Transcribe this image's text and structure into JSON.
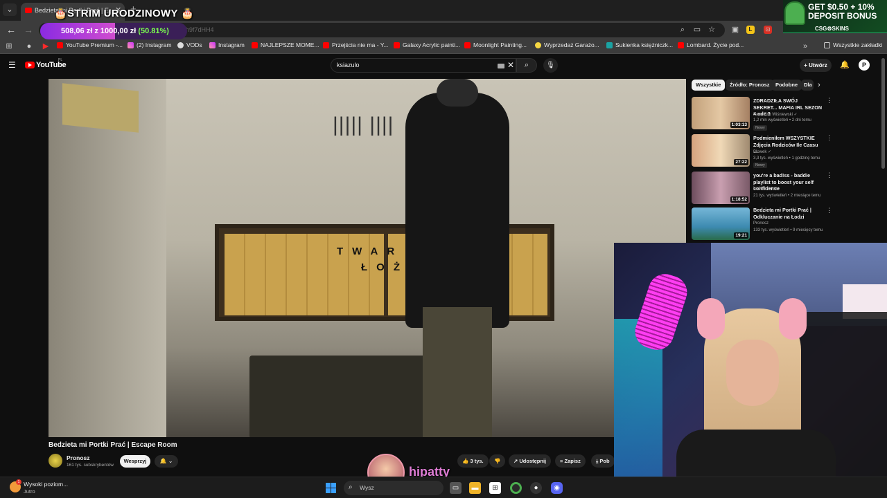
{
  "browser": {
    "tab_title": "Bedzieta mi Portki Prać | Escap",
    "url_fragment": "...zh9f7dHH4",
    "bookmarks": [
      "YouTube Premium -...",
      "(2) Instagram",
      "VODs",
      "Instagram",
      "NAJLEPSZE MOME...",
      "Przejścia nie ma - Y...",
      "Galaxy Acrylic painti...",
      "Moonlight Painting...",
      "Wyprzedaż Garażo...",
      "Sukienka księżniczk...",
      "Lombard. Życie pod..."
    ],
    "all_bookmarks": "Wszystkie zakładki"
  },
  "overlay": {
    "stream_title": "🎂STRIM URODZINOWY 🎂",
    "goal_current": "508,06 zł",
    "goal_sep": "z",
    "goal_target": "1000,00 zł",
    "goal_percent_text": "(50.81%)",
    "goal_fraction": 0.5081,
    "ad_line1": "GET $0.50 + 10%",
    "ad_line2": "DEPOSIT BONUS",
    "ad_brand": "CSG⚙SKINS",
    "streamer_name": "hipatty"
  },
  "youtube": {
    "wordmark": "YouTube",
    "region": "PL",
    "search_value": "ksiazulo",
    "create_label": "Utwórz",
    "avatar_letter": "P",
    "video_title": "Bedzieta mi Portki Prać | Escape Room",
    "video_sign_line1": "TWAR",
    "video_sign_line2": "ŁOŻ",
    "channel_name": "Pronosz",
    "channel_subs": "161 tys. subskrybentów",
    "support_label": "Wesprzyj",
    "likes": "3 tys.",
    "share_label": "Udostępnij",
    "save_label": "Zapisz",
    "more_label": "Pob",
    "chips": [
      "Wszystkie",
      "Źródło: Pronosz",
      "Podobne",
      "Dla"
    ],
    "recommendations": [
      {
        "title": "ZDRADZIŁA SWÓJ SEKRET... MAFIA IRL SEZON 4 odc.3",
        "channel": "Karol Friz Wiśniewski ✓",
        "meta": "1,2 mln wyświetleń • 2 dni temu",
        "badge": "Nowy",
        "duration": "1:03:13"
      },
      {
        "title": "Podmieniłem WSZYSTKIE Zdjęcia Rodziców Ile Czasu ...",
        "channel": "Blowek ✓",
        "meta": "3,3 tys. wyświetleń • 1 godzinę temu",
        "badge": "Nowy",
        "duration": "27:22"
      },
      {
        "title": "you're a bad!ss - baddie playlist to boost your self confidence",
        "channel": "baddie femme",
        "meta": "21 tys. wyświetleń • 2 miesiące temu",
        "badge": "",
        "duration": "1:18:52"
      },
      {
        "title": "Bedzieta mi Portki Prać | Odkluczanie na Łodzi",
        "channel": "Pronosz",
        "meta": "133 tys. wyświetleń • 9 miesięcy temu",
        "badge": "",
        "duration": "19:21"
      }
    ]
  },
  "taskbar": {
    "weather_line1": "Wysoki poziom...",
    "weather_line2": "Jutro",
    "weather_badge": "1",
    "search_placeholder": "Wysz"
  },
  "colors": {
    "yt_red": "#ff0000",
    "goal_green": "#7cff4f",
    "streamer_pink": "#e07dd6"
  }
}
